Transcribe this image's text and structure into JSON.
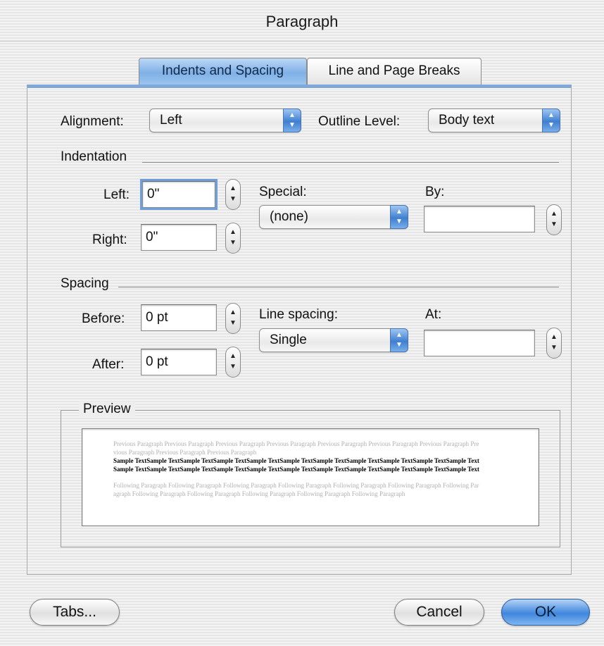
{
  "window": {
    "title": "Paragraph"
  },
  "tabs": [
    {
      "label": "Indents and Spacing",
      "active": true
    },
    {
      "label": "Line and Page Breaks",
      "active": false
    }
  ],
  "general": {
    "alignment_label": "Alignment:",
    "alignment_value": "Left",
    "outline_label": "Outline Level:",
    "outline_value": "Body text"
  },
  "indentation": {
    "heading": "Indentation",
    "left_label": "Left:",
    "left_value": "0\"",
    "right_label": "Right:",
    "right_value": "0\"",
    "special_label": "Special:",
    "special_value": "(none)",
    "by_label": "By:",
    "by_value": ""
  },
  "spacing": {
    "heading": "Spacing",
    "before_label": "Before:",
    "before_value": "0 pt",
    "after_label": "After:",
    "after_value": "0 pt",
    "line_spacing_label": "Line spacing:",
    "line_spacing_value": "Single",
    "at_label": "At:",
    "at_value": ""
  },
  "preview": {
    "heading": "Preview",
    "previous_text": "Previous Paragraph Previous Paragraph Previous Paragraph Previous Paragraph Previous Paragraph Previous Paragraph Previous Paragraph Previous Paragraph Previous Paragraph Previous Paragraph",
    "sample_text": "Sample TextSample TextSample TextSample TextSample TextSample TextSample TextSample TextSample TextSample TextSample TextSample TextSample TextSample TextSample TextSample TextSample TextSample TextSample TextSample TextSample TextSample Text",
    "following_text": "Following Paragraph Following Paragraph Following Paragraph Following Paragraph Following Paragraph Following Paragraph Following Paragraph Following Paragraph Following Paragraph Following Paragraph Following Paragraph Following Paragraph"
  },
  "buttons": {
    "tabs": "Tabs...",
    "cancel": "Cancel",
    "ok": "OK"
  },
  "colors": {
    "accent": "#3f86dd",
    "tab_active": "#7fb0e6"
  }
}
